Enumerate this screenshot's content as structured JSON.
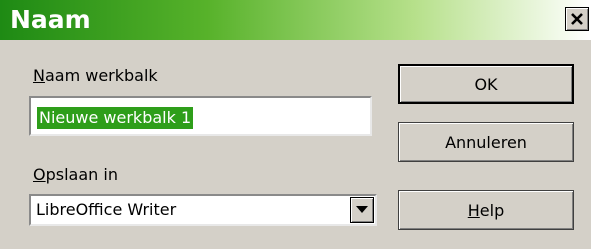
{
  "window": {
    "title": "Naam",
    "close_icon": "close-icon"
  },
  "form": {
    "name_label_hotkey": "N",
    "name_label_rest": "aam werkbalk",
    "name_value": "Nieuwe werkbalk 1",
    "save_label_hotkey": "O",
    "save_label_rest": "pslaan in",
    "save_value": "LibreOffice Writer"
  },
  "buttons": {
    "ok": "OK",
    "cancel": "Annuleren",
    "help_hotkey": "H",
    "help_rest": "elp"
  },
  "colors": {
    "title_green": "#1e8a14",
    "selection_green": "#2e9e1a",
    "dialog_bg": "#d4d0c8"
  }
}
